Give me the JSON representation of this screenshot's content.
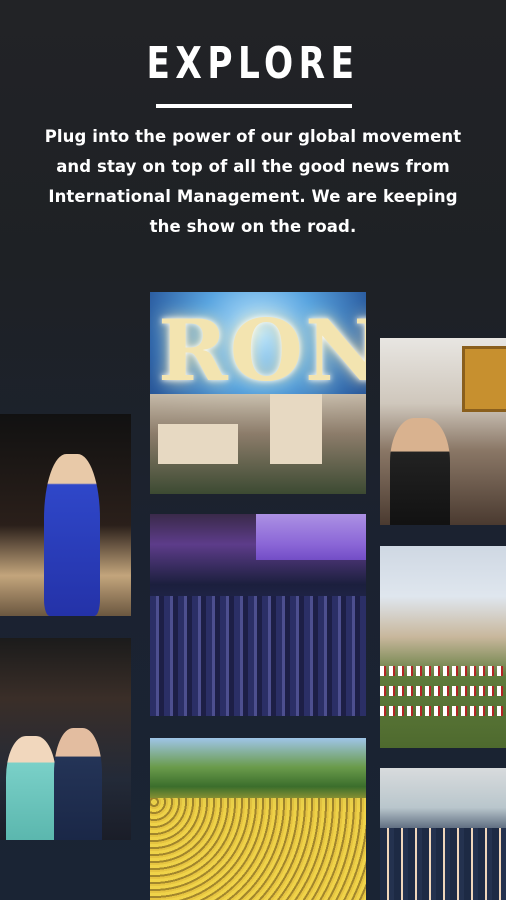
{
  "header": {
    "title": "EXPLORE",
    "description": "Plug into the power of our global movement and stay on top of all the good news from International Management. We are keeping the show on the road."
  },
  "gallery": {
    "tiles": [
      {
        "name": "ron-event-photo",
        "overlay_text": "RON"
      },
      {
        "name": "gala-woman-blue-dress-photo"
      },
      {
        "name": "office-meeting-photo"
      },
      {
        "name": "auditorium-crowd-photo"
      },
      {
        "name": "parade-field-photo"
      },
      {
        "name": "clapping-audience-photo"
      },
      {
        "name": "yellow-shirt-crowd-photo"
      },
      {
        "name": "uniformed-group-photo"
      }
    ]
  },
  "colors": {
    "background_top": "#222326",
    "background_bottom": "#1a2434",
    "text": "#ffffff"
  }
}
